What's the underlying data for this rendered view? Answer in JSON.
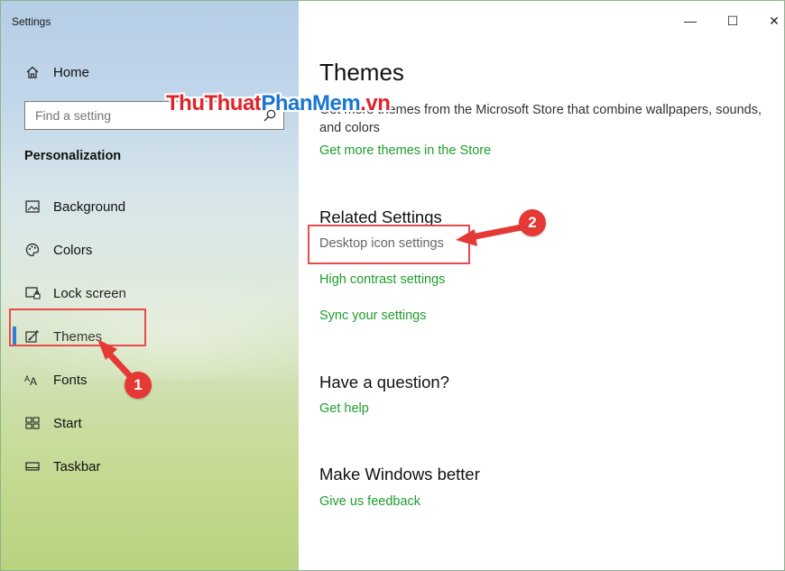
{
  "window": {
    "title": "Settings",
    "minimize_glyph": "—",
    "maximize_glyph": "☐",
    "close_glyph": "✕"
  },
  "sidebar": {
    "home_label": "Home",
    "search_placeholder": "Find a setting",
    "section_label": "Personalization",
    "items": [
      {
        "label": "Background",
        "icon": "image-icon"
      },
      {
        "label": "Colors",
        "icon": "palette-icon"
      },
      {
        "label": "Lock screen",
        "icon": "lock-screen-icon"
      },
      {
        "label": "Themes",
        "icon": "brush-icon"
      },
      {
        "label": "Fonts",
        "icon": "font-icon"
      },
      {
        "label": "Start",
        "icon": "start-tiles-icon"
      },
      {
        "label": "Taskbar",
        "icon": "taskbar-icon"
      }
    ],
    "active_item": "Themes"
  },
  "main": {
    "title": "Themes",
    "description": "Get more themes from the Microsoft Store that combine wallpapers, sounds, and colors",
    "store_link": "Get more themes in the Store",
    "related_heading": "Related Settings",
    "related_links": [
      "Desktop icon settings",
      "High contrast settings",
      "Sync your settings"
    ],
    "question_heading": "Have a question?",
    "help_link": "Get help",
    "better_heading": "Make Windows better",
    "feedback_link": "Give us feedback"
  },
  "annotations": {
    "badge_1": "1",
    "badge_2": "2",
    "color": "#e53935"
  },
  "watermark": {
    "part1": "ThuThuat",
    "part2": "PhanMem",
    "part3": ".vn"
  },
  "colors": {
    "link": "#1e9e2b",
    "accent": "#2e7dd7"
  }
}
